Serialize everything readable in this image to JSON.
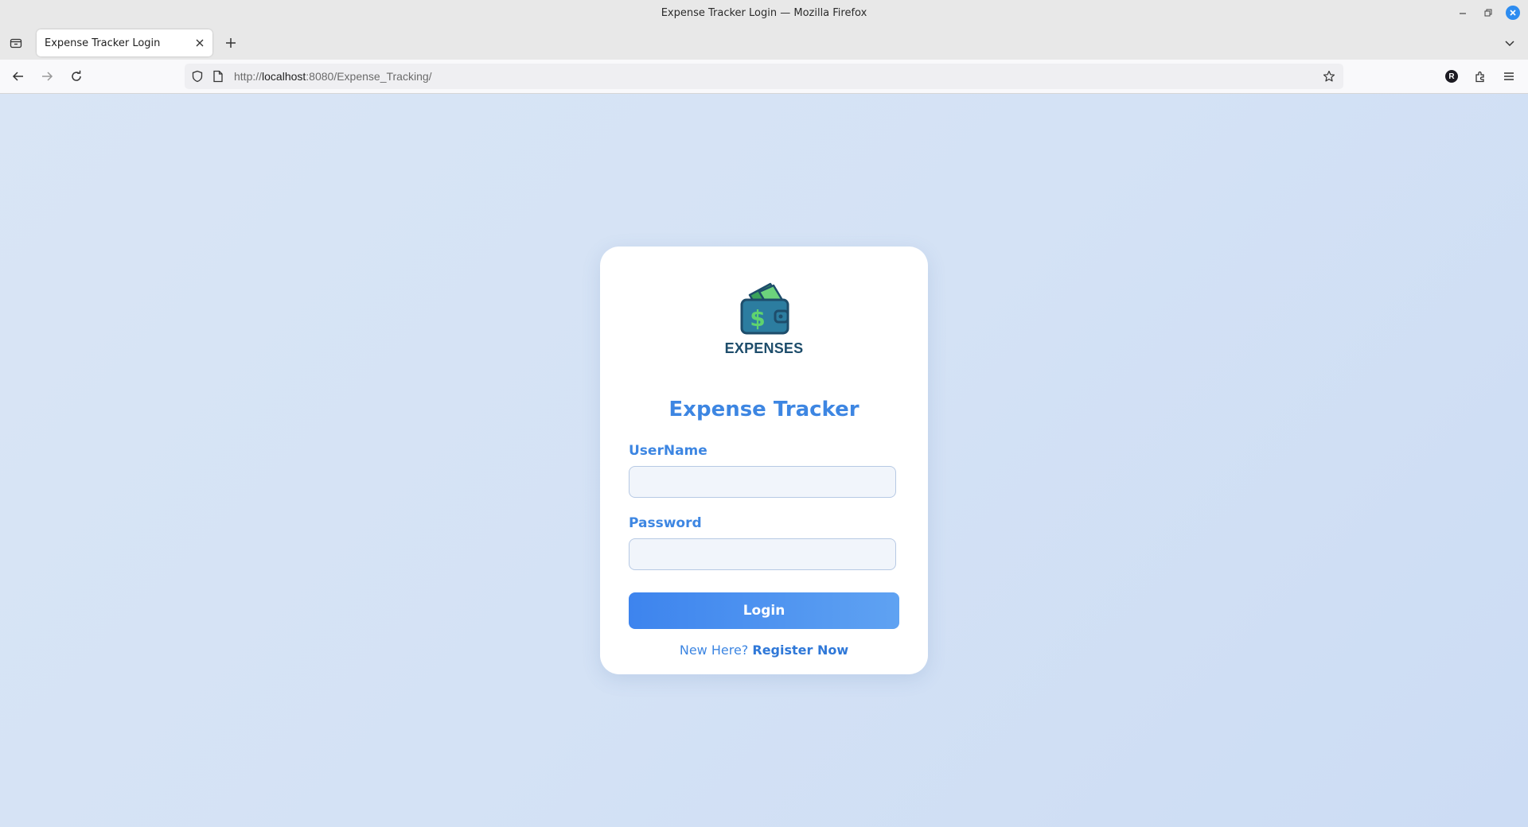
{
  "window": {
    "title": "Expense Tracker Login — Mozilla Firefox"
  },
  "tabs": [
    {
      "title": "Expense Tracker Login",
      "active": true
    }
  ],
  "navbar": {
    "url_prefix": "http://",
    "url_host": "localhost",
    "url_rest": ":8080/Expense_Tracking/",
    "profile_initial": "R"
  },
  "login": {
    "logo_text": "EXPENSES",
    "title": "Expense Tracker",
    "username_label": "UserName",
    "username_value": "",
    "password_label": "Password",
    "password_value": "",
    "login_button": "Login",
    "register_prompt": "New Here?",
    "register_link": "Register Now"
  },
  "colors": {
    "accent": "#3d86e2",
    "page_background": "#d7e3f4",
    "logo_text": "#1e4d6b",
    "wallet": "#2c7da0",
    "money_green": "#4cc05f"
  },
  "icons": [
    "tab-list-icon",
    "close-icon",
    "plus-icon",
    "chevron-down-icon",
    "back-arrow-icon",
    "forward-arrow-icon",
    "reload-icon",
    "shield-icon",
    "page-icon",
    "star-icon",
    "extensions-icon",
    "hamburger-menu-icon",
    "wallet-dollar-icon"
  ]
}
